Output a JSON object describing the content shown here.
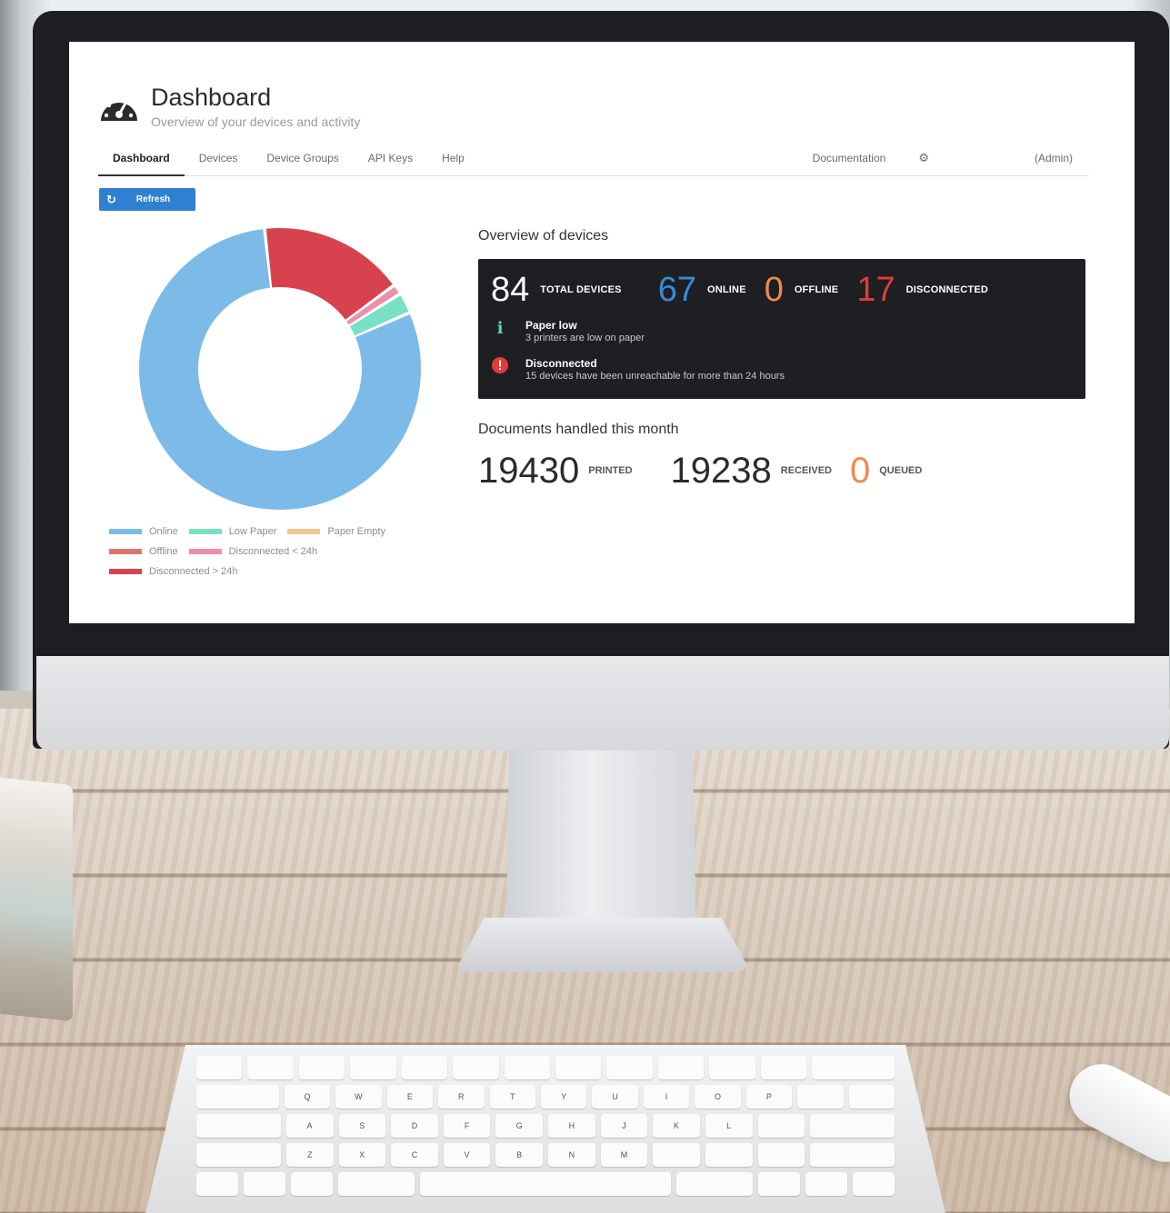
{
  "colors": {
    "online": "#7cbbe8",
    "low_paper": "#79e0c3",
    "paper_empty": "#f4c78f",
    "offline": "#d9776a",
    "disconnected_lt24": "#ec8fa8",
    "disconnected_gt24": "#d6434f",
    "accent": "#2f80d1",
    "stat_online": "#3a8ad6",
    "stat_offline": "#f08a4b",
    "stat_disconnected": "#e23b3b",
    "queued": "#f08a4b"
  },
  "app": {
    "logo_icon": "dashboard-gauge-icon",
    "title": "Dashboard",
    "subtitle": "Overview of your devices and activity"
  },
  "nav": {
    "tabs": [
      "Dashboard",
      "Devices",
      "Device Groups",
      "API Keys",
      "Help"
    ],
    "active": "Dashboard",
    "right": {
      "documentation": "Documentation",
      "settings_icon": "gear-icon",
      "user": "(Admin)"
    }
  },
  "toolbar": {
    "refresh_label": "Refresh",
    "refresh_icon": "refresh-icon"
  },
  "chart_data": {
    "type": "pie",
    "variant": "donut",
    "categories": [
      "Online",
      "Low Paper",
      "Paper Empty",
      "Offline",
      "Disconnected < 24h",
      "Disconnected > 24h"
    ],
    "values": [
      67,
      2,
      0,
      0,
      1,
      14
    ],
    "legend": {
      "online": "Online",
      "low_paper": "Low Paper",
      "paper_empty": "Paper Empty",
      "offline": "Offline",
      "disconnected_lt24": "Disconnected < 24h",
      "disconnected_gt24": "Disconnected > 24h"
    }
  },
  "overview": {
    "title": "Overview of devices",
    "total": {
      "value": "84",
      "label": "TOTAL DEVICES"
    },
    "online": {
      "value": "67",
      "label": "ONLINE"
    },
    "offline": {
      "value": "0",
      "label": "OFFLINE"
    },
    "disconnected": {
      "value": "17",
      "label": "DISCONNECTED"
    },
    "alerts": [
      {
        "icon": "info-icon",
        "title": "Paper low",
        "text": "3 printers are low on paper"
      },
      {
        "icon": "error-icon",
        "title": "Disconnected",
        "text": "15 devices have been unreachable for more than 24 hours"
      }
    ]
  },
  "documents": {
    "title": "Documents handled this month",
    "printed": {
      "value": "19430",
      "label": "PRINTED"
    },
    "received": {
      "value": "19238",
      "label": "RECEIVED"
    },
    "queued": {
      "value": "0",
      "label": "QUEUED"
    }
  }
}
